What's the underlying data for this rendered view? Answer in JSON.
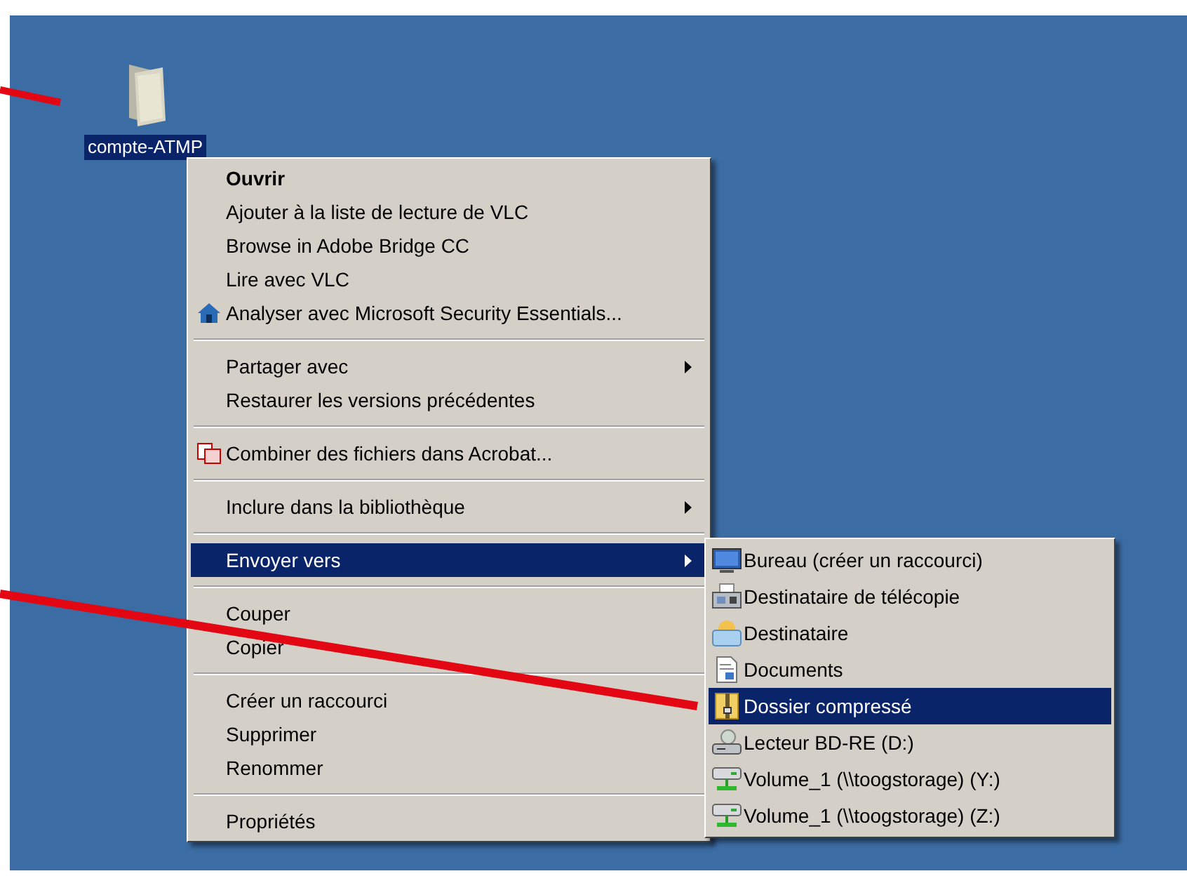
{
  "desktop": {
    "icon": {
      "label": "compte-ATMP",
      "selected": true
    }
  },
  "context_menu": {
    "groups": [
      {
        "items": [
          {
            "label": "Ouvrir",
            "default": true,
            "kind": "plain",
            "has_submenu": false,
            "selected": false
          },
          {
            "label": "Ajouter à la liste de lecture de VLC",
            "default": false,
            "kind": "plain",
            "has_submenu": false,
            "selected": false
          },
          {
            "label": "Browse in Adobe Bridge CC",
            "default": false,
            "kind": "plain",
            "has_submenu": false,
            "selected": false
          },
          {
            "label": "Lire avec VLC",
            "default": false,
            "kind": "plain",
            "has_submenu": false,
            "selected": false
          },
          {
            "label": "Analyser avec Microsoft Security Essentials...",
            "default": false,
            "kind": "security",
            "has_submenu": false,
            "selected": false
          }
        ]
      },
      {
        "items": [
          {
            "label": "Partager avec",
            "default": false,
            "kind": "plain",
            "has_submenu": true,
            "selected": false
          },
          {
            "label": "Restaurer les versions précédentes",
            "default": false,
            "kind": "plain",
            "has_submenu": false,
            "selected": false
          }
        ]
      },
      {
        "items": [
          {
            "label": "Combiner des fichiers dans Acrobat...",
            "default": false,
            "kind": "acrobat",
            "has_submenu": false,
            "selected": false
          }
        ]
      },
      {
        "items": [
          {
            "label": "Inclure dans la bibliothèque",
            "default": false,
            "kind": "plain",
            "has_submenu": true,
            "selected": false
          }
        ]
      },
      {
        "items": [
          {
            "label": "Envoyer vers",
            "default": false,
            "kind": "plain",
            "has_submenu": true,
            "selected": true
          }
        ]
      },
      {
        "items": [
          {
            "label": "Couper",
            "default": false,
            "kind": "plain",
            "has_submenu": false,
            "selected": false
          },
          {
            "label": "Copier",
            "default": false,
            "kind": "plain",
            "has_submenu": false,
            "selected": false
          }
        ]
      },
      {
        "items": [
          {
            "label": "Créer un raccourci",
            "default": false,
            "kind": "plain",
            "has_submenu": false,
            "selected": false
          },
          {
            "label": "Supprimer",
            "default": false,
            "kind": "plain",
            "has_submenu": false,
            "selected": false
          },
          {
            "label": "Renommer",
            "default": false,
            "kind": "plain",
            "has_submenu": false,
            "selected": false
          }
        ]
      },
      {
        "items": [
          {
            "label": "Propriétés",
            "default": false,
            "kind": "plain",
            "has_submenu": false,
            "selected": false
          }
        ]
      }
    ]
  },
  "submenu": {
    "items": [
      {
        "label": "Bureau (créer un raccourci)",
        "kind": "desktop",
        "selected": false
      },
      {
        "label": "Destinataire de télécopie",
        "kind": "fax",
        "selected": false
      },
      {
        "label": "Destinataire",
        "kind": "mail",
        "selected": false
      },
      {
        "label": "Documents",
        "kind": "document",
        "selected": false
      },
      {
        "label": "Dossier compressé",
        "kind": "zip",
        "selected": true
      },
      {
        "label": "Lecteur BD-RE (D:)",
        "kind": "drive",
        "selected": false
      },
      {
        "label": "Volume_1 (\\\\toogstorage) (Y:)",
        "kind": "network",
        "selected": false
      },
      {
        "label": "Volume_1 (\\\\toogstorage) (Z:)",
        "kind": "network",
        "selected": false
      }
    ]
  }
}
